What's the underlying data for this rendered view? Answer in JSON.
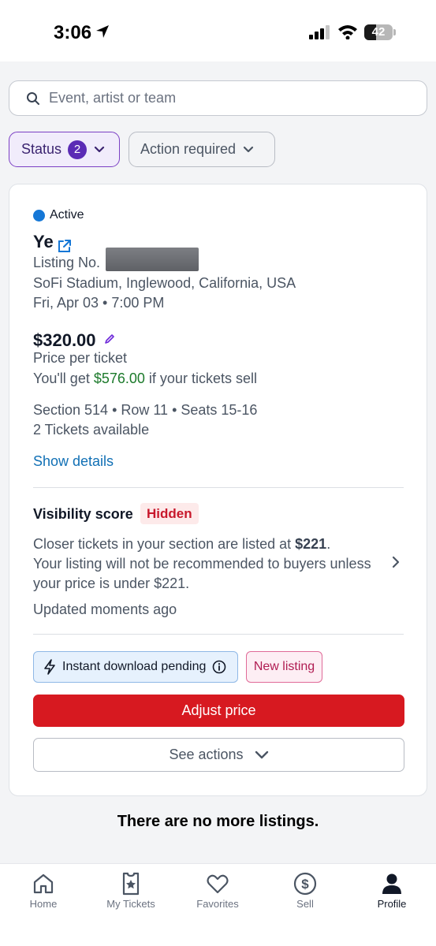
{
  "status_bar": {
    "time": "3:06",
    "battery": "42",
    "battery_level": 0.42
  },
  "search": {
    "placeholder": "Event, artist or team",
    "value": ""
  },
  "filters": {
    "status_label": "Status",
    "status_count": "2",
    "action_label": "Action required"
  },
  "listing": {
    "status": "Active",
    "status_color": "#1577d6",
    "event_name": "Ye",
    "listing_label": "Listing No.",
    "venue": "SoFi Stadium, Inglewood, California, USA",
    "date": "Fri, Apr 03 • 7:00 PM",
    "price": "$320.00",
    "price_caption": "Price per ticket",
    "earnings_prefix": "You'll get ",
    "earnings_amount": "$576.00",
    "earnings_suffix": " if your tickets sell",
    "seats": "Section 514 • Row 11 • Seats 15-16",
    "tickets_available": "2 Tickets available",
    "show_details": "Show details",
    "visibility_title": "Visibility score",
    "visibility_badge": "Hidden",
    "visibility_line1_prefix": "Closer tickets in your section are listed at ",
    "visibility_line1_amount": "$221",
    "visibility_line1_suffix": ".",
    "visibility_line2": "Your listing will not be recommended to buyers unless your price is under $221.",
    "updated": "Updated moments ago",
    "instant_download": "Instant download pending",
    "new_listing": "New listing",
    "adjust_price": "Adjust price",
    "see_actions": "See actions"
  },
  "no_more": "There are no more listings.",
  "tabs": [
    {
      "label": "Home",
      "icon": "home-icon"
    },
    {
      "label": "My Tickets",
      "icon": "ticket-icon"
    },
    {
      "label": "Favorites",
      "icon": "heart-icon"
    },
    {
      "label": "Sell",
      "icon": "dollar-icon"
    },
    {
      "label": "Profile",
      "icon": "person-icon",
      "active": true
    }
  ],
  "colors": {
    "accent_purple": "#5b2bb5",
    "primary_red": "#d71920",
    "earn_green": "#1c7a2b",
    "link_blue": "#1170b5"
  }
}
